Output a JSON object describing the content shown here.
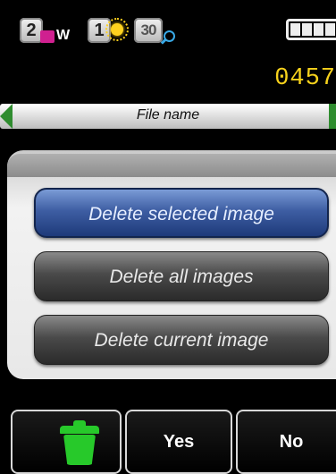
{
  "status": {
    "badge_wb": "2",
    "wb_text": "W",
    "badge_flash": "1",
    "badge_zoom": "30",
    "battery_icon": "battery-icon",
    "counter": "0457"
  },
  "filebar": {
    "label": "File name"
  },
  "menu": {
    "items": [
      {
        "label": "Delete selected image",
        "selected": true
      },
      {
        "label": "Delete all images",
        "selected": false
      },
      {
        "label": "Delete current image",
        "selected": false
      }
    ]
  },
  "bottom": {
    "trash_icon": "trash-icon",
    "yes_label": "Yes",
    "no_label": "No"
  },
  "colors": {
    "counter": "#f7d21c",
    "selected": "#3e5ea3",
    "trash": "#27c92a"
  }
}
